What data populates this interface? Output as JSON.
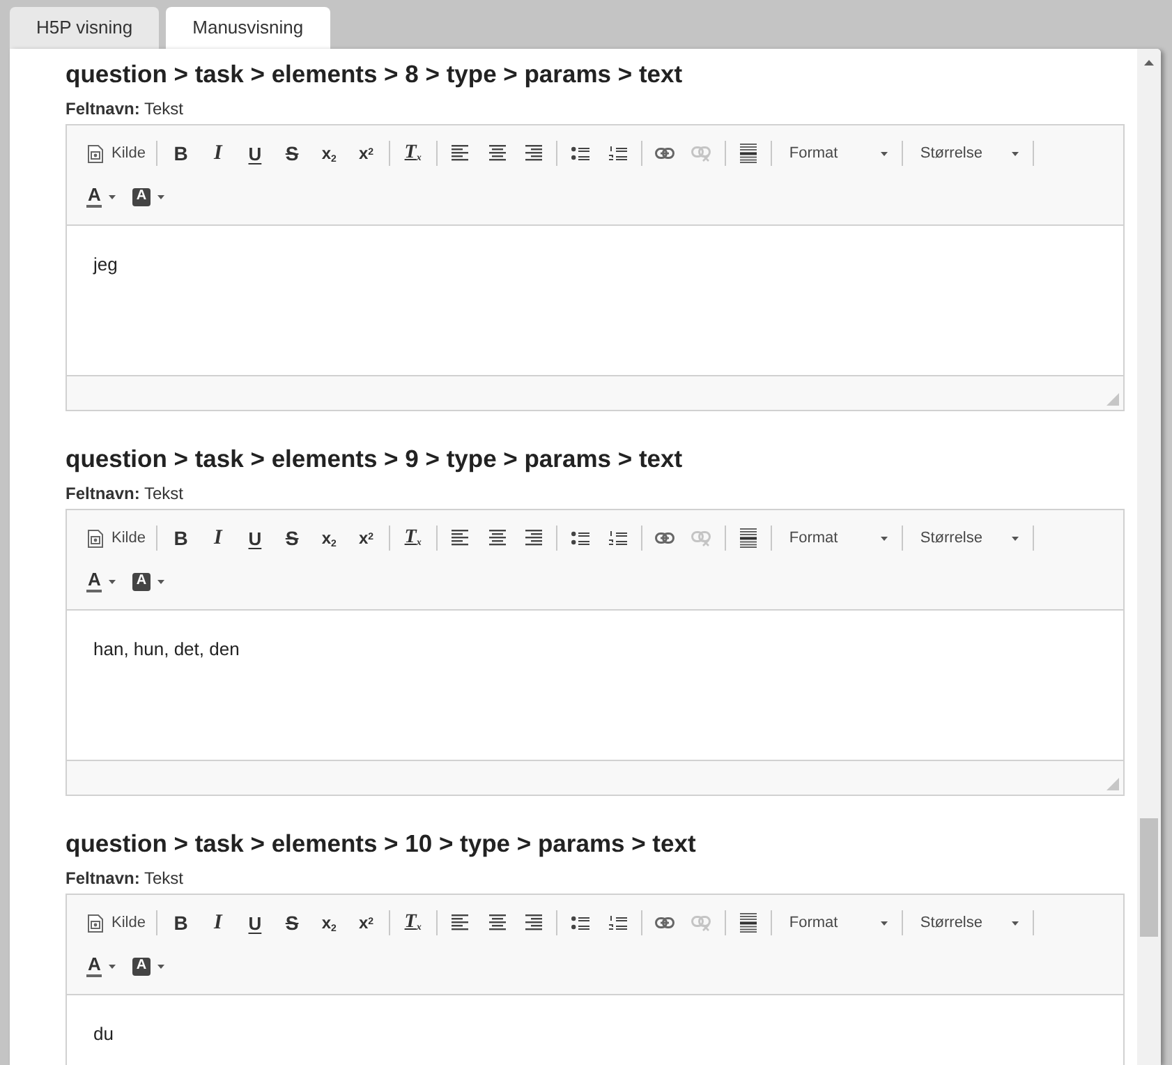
{
  "tabs": [
    {
      "label": "H5P visning",
      "selected": false
    },
    {
      "label": "Manusvisning",
      "selected": true
    }
  ],
  "fields": [
    {
      "heading": "question > task > elements > 8 > type > params > text",
      "field_label": "**Feltnavn:** Tekst",
      "editor": {
        "toolbar": [
          [
            [
              {
                "kind": "source",
                "label": "Kilde",
                "disabled": false
              }
            ],
            [
              {
                "kind": "bold",
                "glyph": "B",
                "disabled": false
              },
              {
                "kind": "italic",
                "glyph": "I",
                "disabled": false
              },
              {
                "kind": "underline",
                "glyph": "U",
                "disabled": false
              },
              {
                "kind": "strike",
                "glyph": "S",
                "disabled": false
              },
              {
                "kind": "subscript",
                "glyph": "x$_{2}$",
                "disabled": false
              },
              {
                "kind": "superscript",
                "glyph": "x$^{2}$",
                "disabled": false
              }
            ],
            [
              {
                "kind": "remove-format",
                "glyph": "T$_{x}$",
                "disabled": false
              }
            ],
            [
              {
                "kind": "align-left",
                "disabled": false
              },
              {
                "kind": "align-center",
                "disabled": false
              },
              {
                "kind": "align-right",
                "disabled": false
              }
            ],
            [
              {
                "kind": "bulleted-list",
                "disabled": false
              },
              {
                "kind": "numbered-list",
                "disabled": false
              }
            ],
            [
              {
                "kind": "link",
                "disabled": false
              },
              {
                "kind": "unlink",
                "disabled": true
              }
            ],
            [
              {
                "kind": "horizontal-rule",
                "disabled": false
              }
            ],
            [
              {
                "kind": "format-combo",
                "label": "Format",
                "disabled": false
              }
            ],
            [
              {
                "kind": "size-combo",
                "label": "Størrelse",
                "disabled": false
              }
            ]
          ],
          [
            [
              {
                "kind": "text-color",
                "glyph": "A",
                "disabled": false
              },
              {
                "kind": "bg-color",
                "glyph": "A",
                "disabled": false
              }
            ]
          ]
        ],
        "content": "jeg"
      }
    },
    {
      "heading": "question > task > elements > 9 > type > params > text",
      "field_label": "**Feltnavn:** Tekst",
      "editor": {
        "toolbar": [
          [
            [
              {
                "kind": "source",
                "label": "Kilde",
                "disabled": false
              }
            ],
            [
              {
                "kind": "bold",
                "glyph": "B",
                "disabled": false
              },
              {
                "kind": "italic",
                "glyph": "I",
                "disabled": false
              },
              {
                "kind": "underline",
                "glyph": "U",
                "disabled": false
              },
              {
                "kind": "strike",
                "glyph": "S",
                "disabled": false
              },
              {
                "kind": "subscript",
                "glyph": "x$_{2}$",
                "disabled": false
              },
              {
                "kind": "superscript",
                "glyph": "x$^{2}$",
                "disabled": false
              }
            ],
            [
              {
                "kind": "remove-format",
                "glyph": "T$_{x}$",
                "disabled": false
              }
            ],
            [
              {
                "kind": "align-left",
                "disabled": false
              },
              {
                "kind": "align-center",
                "disabled": false
              },
              {
                "kind": "align-right",
                "disabled": false
              }
            ],
            [
              {
                "kind": "bulleted-list",
                "disabled": false
              },
              {
                "kind": "numbered-list",
                "disabled": false
              }
            ],
            [
              {
                "kind": "link",
                "disabled": false
              },
              {
                "kind": "unlink",
                "disabled": true
              }
            ],
            [
              {
                "kind": "horizontal-rule",
                "disabled": false
              }
            ],
            [
              {
                "kind": "format-combo",
                "label": "Format",
                "disabled": false
              }
            ],
            [
              {
                "kind": "size-combo",
                "label": "Størrelse",
                "disabled": false
              }
            ]
          ],
          [
            [
              {
                "kind": "text-color",
                "glyph": "A",
                "disabled": false
              },
              {
                "kind": "bg-color",
                "glyph": "A",
                "disabled": false
              }
            ]
          ]
        ],
        "content": "han, hun, det, den"
      }
    },
    {
      "heading": "question > task > elements > 10 > type > params > text",
      "field_label": "**Feltnavn:** Tekst",
      "editor": {
        "toolbar": [
          [
            [
              {
                "kind": "source",
                "label": "Kilde",
                "disabled": false
              }
            ],
            [
              {
                "kind": "bold",
                "glyph": "B",
                "disabled": false
              },
              {
                "kind": "italic",
                "glyph": "I",
                "disabled": false
              },
              {
                "kind": "underline",
                "glyph": "U",
                "disabled": false
              },
              {
                "kind": "strike",
                "glyph": "S",
                "disabled": false
              },
              {
                "kind": "subscript",
                "glyph": "x$_{2}$",
                "disabled": false
              },
              {
                "kind": "superscript",
                "glyph": "x$^{2}$",
                "disabled": false
              }
            ],
            [
              {
                "kind": "remove-format",
                "glyph": "T$_{x}$",
                "disabled": false
              }
            ],
            [
              {
                "kind": "align-left",
                "disabled": false
              },
              {
                "kind": "align-center",
                "disabled": false
              },
              {
                "kind": "align-right",
                "disabled": false
              }
            ],
            [
              {
                "kind": "bulleted-list",
                "disabled": false
              },
              {
                "kind": "numbered-list",
                "disabled": false
              }
            ],
            [
              {
                "kind": "link",
                "disabled": false
              },
              {
                "kind": "unlink",
                "disabled": true
              }
            ],
            [
              {
                "kind": "horizontal-rule",
                "disabled": false
              }
            ],
            [
              {
                "kind": "format-combo",
                "label": "Format",
                "disabled": false
              }
            ],
            [
              {
                "kind": "size-combo",
                "label": "Størrelse",
                "disabled": false
              }
            ]
          ],
          [
            [
              {
                "kind": "text-color",
                "glyph": "A",
                "disabled": false
              },
              {
                "kind": "bg-color",
                "glyph": "A",
                "disabled": false
              }
            ]
          ]
        ],
        "content": "du"
      }
    }
  ]
}
